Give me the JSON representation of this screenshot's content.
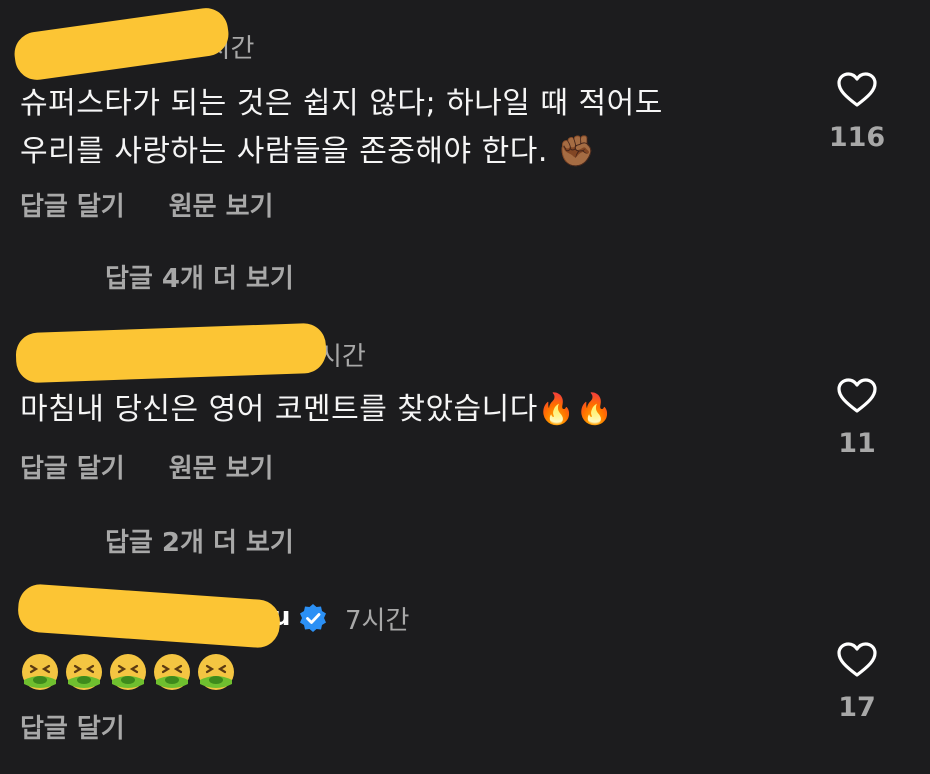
{
  "comments": [
    {
      "time": "9시간",
      "text": "슈퍼스타가 되는 것은 쉽지 않다; 하나일 때 적어도\n우리를 사랑하는 사람들을 존중해야 한다. ✊🏾",
      "reply_label": "답글 달기",
      "translate_label": "원문 보기",
      "like_count": "116",
      "more_replies": "답글 4개 더 보기"
    },
    {
      "time": "시간",
      "text": "마침내 당신은 영어 코멘트를 찾았습니다🔥🔥",
      "reply_label": "답글 달기",
      "translate_label": "원문 보기",
      "like_count": "11",
      "more_replies": "답글 2개 더 보기"
    },
    {
      "time": "7시간",
      "username_tail": "u",
      "reply_label": "답글 달기",
      "like_count": "17"
    }
  ],
  "icons": {
    "like": "heart-outline-icon",
    "verified": "verified-badge-icon",
    "emoji_row": "nauseated-face-emoji"
  },
  "colors": {
    "background": "#1c1c1e",
    "secondary_text": "#a8a8a8",
    "redaction": "#fcc534",
    "verified": "#2b90f5"
  }
}
